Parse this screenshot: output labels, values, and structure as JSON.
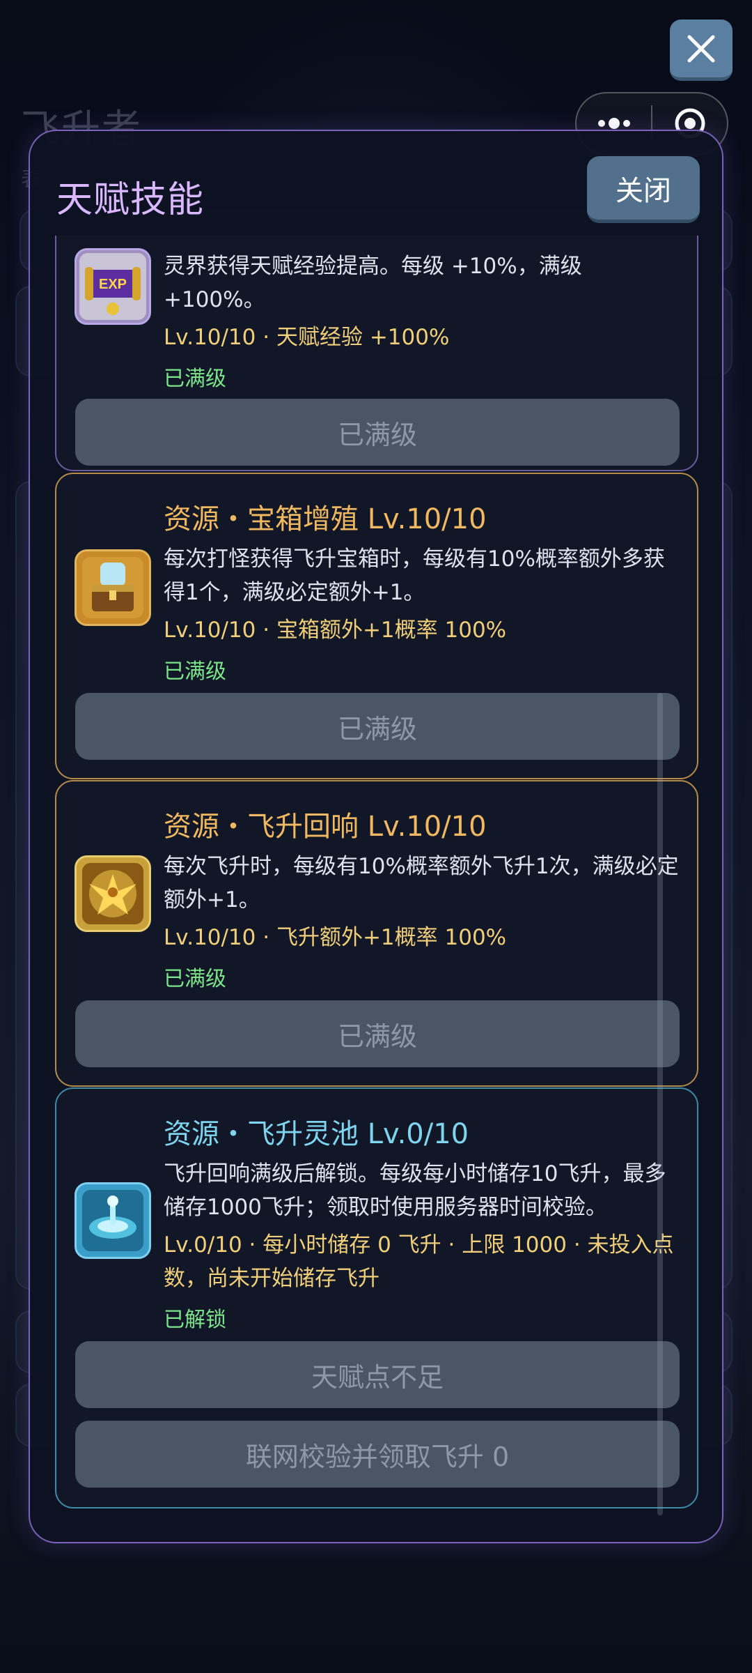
{
  "background": {
    "title": "飞升者",
    "subtitle": "表"
  },
  "system": {
    "close_icon": "close-icon",
    "menu_icon": "more-dots-icon",
    "target_icon": "target-icon"
  },
  "modal": {
    "title": "天赋技能",
    "close_label": "关闭"
  },
  "talents": [
    {
      "name": "",
      "description": "灵界获得天赋经验提高。每级 +10%，满级 +100%。",
      "stat": "Lv.10/10 · 天赋经验 +100%",
      "status": "已满级",
      "button": "已满级",
      "icon": "exp-scroll-icon",
      "level": 10,
      "max_level": 10
    },
    {
      "name": "资源・宝箱增殖 Lv.10/10",
      "description": "每次打怪获得飞升宝箱时，每级有10%概率额外多获得1个，满级必定额外+1。",
      "stat": "Lv.10/10 · 宝箱额外+1概率 100%",
      "status": "已满级",
      "button": "已满级",
      "icon": "treasure-chest-icon",
      "level": 10,
      "max_level": 10
    },
    {
      "name": "资源・飞升回响 Lv.10/10",
      "description": "每次飞升时，每级有10%概率额外飞升1次，满级必定额外+1。",
      "stat": "Lv.10/10 · 飞升额外+1概率 100%",
      "status": "已满级",
      "button": "已满级",
      "icon": "golden-phoenix-icon",
      "level": 10,
      "max_level": 10
    },
    {
      "name": "资源・飞升灵池 Lv.0/10",
      "description": "飞升回响满级后解锁。每级每小时储存10飞升，最多储存1000飞升；领取时使用服务器时间校验。",
      "stat": "Lv.0/10 · 每小时储存 0 飞升 · 上限 1000 · 未投入点数，尚未开始储存飞升",
      "status": "已解锁",
      "button": "天赋点不足",
      "button2": "联网校验并领取飞升 0",
      "icon": "spirit-pool-icon",
      "level": 0,
      "max_level": 10
    }
  ]
}
